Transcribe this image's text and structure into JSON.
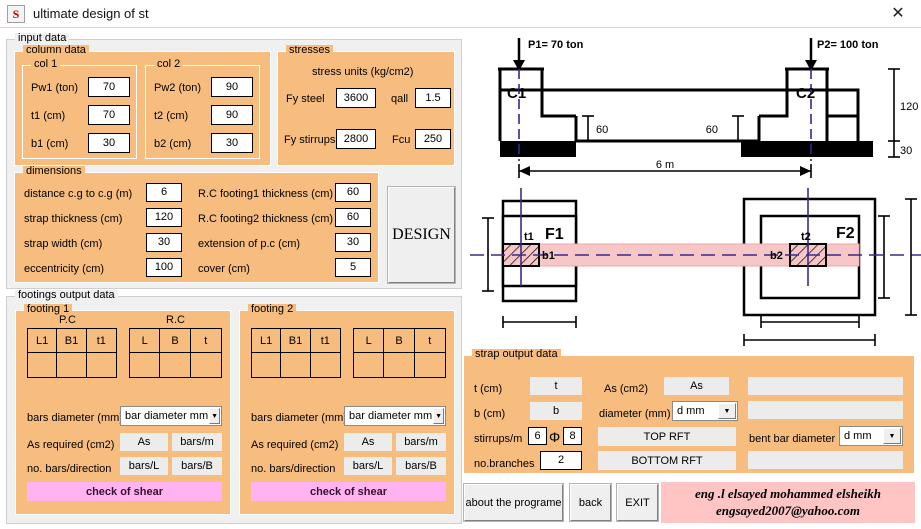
{
  "window": {
    "title": "ultimate design of st",
    "icon": "S",
    "close_icon": "✕"
  },
  "input_data": {
    "legend": "input data",
    "column_data": {
      "legend": "column data",
      "col1": {
        "legend": "col 1",
        "rows": [
          {
            "label": "Pw1  (ton)",
            "value": "70"
          },
          {
            "label": "t1 (cm)",
            "value": "70"
          },
          {
            "label": "b1 (cm)",
            "value": "30"
          }
        ]
      },
      "col2": {
        "legend": "col 2",
        "rows": [
          {
            "label": "Pw2 (ton)",
            "value": "90"
          },
          {
            "label": "t2 (cm)",
            "value": "90"
          },
          {
            "label": "b2 (cm)",
            "value": "30"
          }
        ]
      }
    },
    "stresses": {
      "legend": "stresses",
      "units_label": "stress units (kg/cm2)",
      "fy_steel_label": "Fy steel",
      "fy_steel_value": "3600",
      "qall_label": "qall",
      "qall_value": "1.5",
      "fy_stirrups_label": "Fy stirrups",
      "fy_stirrups_value": "2800",
      "fcu_label": "Fcu",
      "fcu_value": "250"
    },
    "dimensions": {
      "legend": "dimensions",
      "left_rows": [
        {
          "label": "distance c.g to c.g (m)",
          "value": "6"
        },
        {
          "label": "strap thickness (cm)",
          "value": "120"
        },
        {
          "label": "strap width (cm)",
          "value": "30"
        },
        {
          "label": "eccentricity (cm)",
          "value": "100"
        }
      ],
      "right_rows": [
        {
          "label": "R.C footing1 thickness (cm)",
          "value": "60"
        },
        {
          "label": "R.C footing2 thickness (cm)",
          "value": "60"
        },
        {
          "label": "extension of p.c (cm)",
          "value": "30"
        },
        {
          "label": "cover (cm)",
          "value": "5"
        }
      ]
    },
    "design_button": "DESIGN"
  },
  "footings_output": {
    "legend": "footings output data",
    "footing1": {
      "legend": "footing 1",
      "pc_label": "P.C",
      "rc_label": "R.C",
      "pc_headers": [
        "L1",
        "B1",
        "t1"
      ],
      "pc_values": [
        "",
        "",
        ""
      ],
      "rc_headers": [
        "L",
        "B",
        "t"
      ],
      "rc_values": [
        "",
        "",
        ""
      ],
      "bars_diameter_label": "bars diameter (mm)",
      "bars_diameter_value": "bar diameter mm",
      "as_required_label": "As required (cm2)",
      "as_value": "As",
      "bars_per_m": "bars/m",
      "no_bars_label": "no. bars/direction",
      "bars_L": "bars/L",
      "bars_B": "bars/B",
      "check_shear": "check of shear"
    },
    "footing2": {
      "legend": "footing 2",
      "pc_headers": [
        "L1",
        "B1",
        "t1"
      ],
      "pc_values": [
        "",
        "",
        ""
      ],
      "rc_headers": [
        "L",
        "B",
        "t"
      ],
      "rc_values": [
        "",
        "",
        ""
      ],
      "bars_diameter_label": "bars diameter (mm)",
      "bars_diameter_value": "bar diameter mm",
      "as_required_label": "As required (cm2)",
      "as_value": "As",
      "bars_per_m": "bars/m",
      "no_bars_label": "no. bars/direction",
      "bars_L": "bars/L",
      "bars_B": "bars/B",
      "check_shear": "check of shear"
    }
  },
  "strap_output": {
    "legend": "strap output data",
    "t_label": "t (cm)",
    "t_value": "t",
    "b_label": "b (cm)",
    "b_value": "b",
    "stirrups_label": "stirrups/m",
    "stirrups_count": "6",
    "stirrups_phi": "Φ",
    "stirrups_diameter": "8",
    "branches_label": "no.branches",
    "branches_value": "2",
    "as_label": "As (cm2)",
    "as_value": "As",
    "diameter_label": "diameter (mm)",
    "diameter_value": "d mm",
    "top_rft": "TOP RFT",
    "bottom_rft": "BOTTOM RFT",
    "bent_bar_label": "bent bar diameter",
    "bent_bar_value": "d mm",
    "blank_fields": [
      "",
      "",
      ""
    ]
  },
  "bottom_bar": {
    "about_button": "about the programe",
    "back_button": "back",
    "exit_button": "EXIT",
    "signature_line1": "eng .l elsayed mohammed elsheikh",
    "signature_line2": "engsayed2007@yahoo.com"
  },
  "elevation_drawing": {
    "p1_label": "P1= 70 ton",
    "p2_label": "P2= 100 ton",
    "c1_label": "C1",
    "c2_label": "C2",
    "dim_60_left": "60",
    "dim_60_right": "60",
    "dim_120": "120",
    "dim_30": "30",
    "span_label": "6 m"
  },
  "plan_drawing": {
    "f1_label": "F1",
    "f2_label": "F2",
    "t1_label": "t1",
    "b1_label": "b1",
    "t2_label": "t2",
    "b2_label": "b2",
    "strap_color": "#f7c6c6",
    "centerline_color": "#3a2a8c"
  },
  "colors": {
    "panel_peach": "#f7bd7f",
    "window_grey": "#f0f0f0",
    "pink_action": "#ffb3f0",
    "signature_pink": "#ffc4c4"
  }
}
